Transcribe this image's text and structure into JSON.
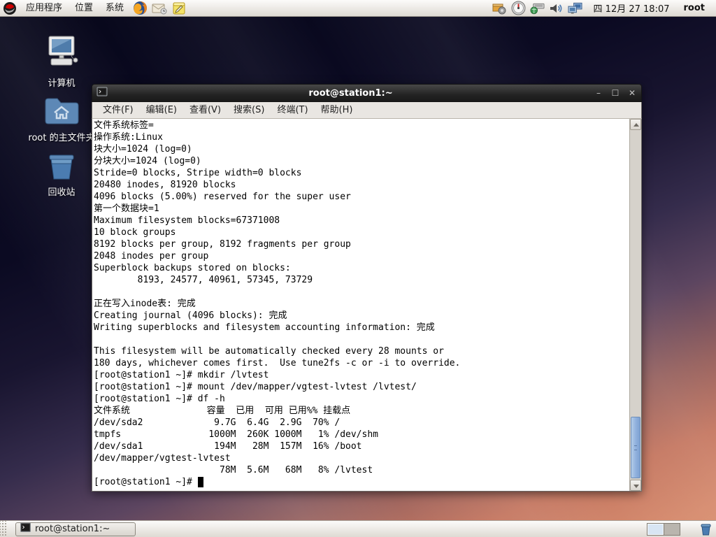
{
  "top_panel": {
    "menus": [
      {
        "label": "应用程序"
      },
      {
        "label": "位置"
      },
      {
        "label": "系统"
      }
    ],
    "launchers": [
      "firefox-icon",
      "email-icon",
      "notes-icon"
    ],
    "tray_icons": [
      "package-updates-icon",
      "system-monitor-icon",
      "keyboard-indicator-icon",
      "volume-icon",
      "network-displays-icon"
    ],
    "clock": "四 12月 27 18:07",
    "username": "root"
  },
  "desktop": {
    "icons": [
      {
        "label": "计算机"
      },
      {
        "label": "root 的主文件夹"
      },
      {
        "label": "回收站"
      }
    ]
  },
  "terminal": {
    "title": "root@station1:~",
    "window_buttons": {
      "minimize": "–",
      "maximize": "☐",
      "close": "✕"
    },
    "menu": [
      {
        "label": "文件(F)"
      },
      {
        "label": "编辑(E)"
      },
      {
        "label": "查看(V)"
      },
      {
        "label": "搜索(S)"
      },
      {
        "label": "终端(T)"
      },
      {
        "label": "帮助(H)"
      }
    ],
    "output": "文件系统标签=\n操作系统:Linux\n块大小=1024 (log=0)\n分块大小=1024 (log=0)\nStride=0 blocks, Stripe width=0 blocks\n20480 inodes, 81920 blocks\n4096 blocks (5.00%) reserved for the super user\n第一个数据块=1\nMaximum filesystem blocks=67371008\n10 block groups\n8192 blocks per group, 8192 fragments per group\n2048 inodes per group\nSuperblock backups stored on blocks: \n        8193, 24577, 40961, 57345, 73729\n\n正在写入inode表: 完成\nCreating journal (4096 blocks): 完成\nWriting superblocks and filesystem accounting information: 完成\n\nThis filesystem will be automatically checked every 28 mounts or\n180 days, whichever comes first.  Use tune2fs -c or -i to override.\n[root@station1 ~]# mkdir /lvtest\n[root@station1 ~]# mount /dev/mapper/vgtest-lvtest /lvtest/\n[root@station1 ~]# df -h\n文件系统              容量  已用  可用 已用%% 挂载点\n/dev/sda2             9.7G  6.4G  2.9G  70% /\ntmpfs                1000M  260K 1000M   1% /dev/shm\n/dev/sda1             194M   28M  157M  16% /boot\n/dev/mapper/vgtest-lvtest\n                       78M  5.6M   68M   8% /lvtest\n[root@station1 ~]# ",
    "df_table": {
      "headers": [
        "文件系统",
        "容量",
        "已用",
        "可用",
        "已用%%",
        "挂载点"
      ],
      "rows": [
        [
          "/dev/sda2",
          "9.7G",
          "6.4G",
          "2.9G",
          "70%",
          "/"
        ],
        [
          "tmpfs",
          "1000M",
          "260K",
          "1000M",
          "1%",
          "/dev/shm"
        ],
        [
          "/dev/sda1",
          "194M",
          "28M",
          "157M",
          "16%",
          "/boot"
        ],
        [
          "/dev/mapper/vgtest-lvtest",
          "78M",
          "5.6M",
          "68M",
          "8%",
          "/lvtest"
        ]
      ]
    }
  },
  "taskbar": {
    "task_button": {
      "label": "root@station1:~"
    },
    "workspaces": {
      "count": 2,
      "active": 1
    }
  },
  "colors": {
    "titlebar_bg": "#232323",
    "menubar_bg": "#e9e6e2",
    "panel_bg": "#dedad3",
    "scrollbar_thumb": "#8fb0dd",
    "workspace_active": "#d8e5f3",
    "wallpaper_top": "#0b0a22",
    "wallpaper_bottom": "#d68b6e",
    "terminal_bg": "#ffffff",
    "terminal_fg": "#000000"
  }
}
